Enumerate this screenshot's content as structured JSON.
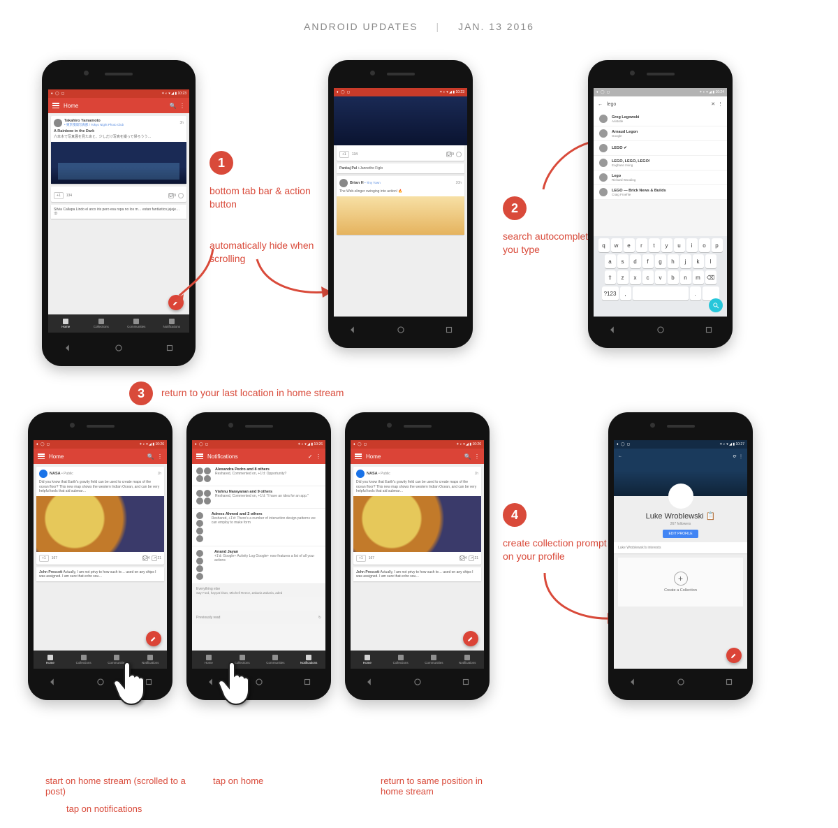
{
  "header": {
    "title": "ANDROID UPDATES",
    "date": "JAN. 13 2016"
  },
  "badges": {
    "b1": "1",
    "b2": "2",
    "b3": "3",
    "b4": "4"
  },
  "annotations": {
    "a1a": "bottom tab bar & action button",
    "a1b": "automatically hide when scrolling",
    "a2": "search autocomplete as you type",
    "a3": "return to your last location in home stream",
    "a4": "create collection prompt on your profile",
    "c1a": "start on home stream (scrolled to a post)",
    "c1b": "tap on notifications",
    "c2": "tap on home",
    "c3": "return to same position in home stream"
  },
  "status": {
    "time1": "10:23",
    "time2": "10:23",
    "time3": "10:24",
    "time4": "10:26",
    "time5": "10:26",
    "time6": "10:26",
    "time7": "10:27"
  },
  "tabs": {
    "home": "Home",
    "collections": "Collections",
    "communities": "Communities",
    "notifications": "Notifications"
  },
  "p1": {
    "appbar": "Home",
    "post1_author": "Takahiro Yamamoto",
    "post1_sub": "• 東京夜間写真部 / Tokyo Night Photo Club",
    "post1_title": "A Rainbow in the Dark",
    "post1_body": "六本木で写真展を見たあと、少しだけ写真を撮って帰ろうう…",
    "post1_time": "3h",
    "plus": "+1",
    "count": "134",
    "comments": "9",
    "snippet": "Silvia Callapa Lindo el arco iris pero esa ropa no los m… estan fantástico jejeje… :D"
  },
  "p2": {
    "plus": "+1",
    "count": "134",
    "comments": "9",
    "post_author": "Pankaj Pal",
    "post_via": "+Jannethe Figlo",
    "post2_author": "Brian H",
    "post2_via": "• Tiny Town",
    "post2_time": "20h",
    "post2_body": "The Web-slinger swinging into action! 🔥"
  },
  "p3": {
    "query": "lego",
    "results": [
      {
        "name": "Greg Legowski",
        "sub": "Aristotle"
      },
      {
        "name": "Arnaud Legon",
        "sub": "Google"
      },
      {
        "name": "LEGO ✔",
        "sub": ""
      },
      {
        "name": "LEGO, LEGO, LEGO!",
        "sub": "Eoghann Irving"
      },
      {
        "name": "Lego",
        "sub": "Richard Wooding"
      },
      {
        "name": "LEGO — Brick News & Builds",
        "sub": "Craig Froehle"
      }
    ],
    "keys_r1": [
      "q",
      "w",
      "e",
      "r",
      "t",
      "y",
      "u",
      "i",
      "o",
      "p"
    ],
    "keys_r2": [
      "a",
      "s",
      "d",
      "f",
      "g",
      "h",
      "j",
      "k",
      "l"
    ],
    "keys_r3": [
      "⇧",
      "z",
      "x",
      "c",
      "v",
      "b",
      "n",
      "m",
      "⌫"
    ],
    "keys_r4": [
      "?123",
      ",",
      "."
    ]
  },
  "home2": {
    "appbar": "Home",
    "post_author": "NASA",
    "post_via": "• Public",
    "post_time": "1h",
    "post_body": "Did you know that Earth's gravity field can be used to create maps of the ocean floor? This new map shows the western Indian Ocean, and can be very helpful tools that aid submar…",
    "plus": "+1",
    "count": "167",
    "comments": "4",
    "shares": "21",
    "snippet_name": "John Prescott",
    "snippet": " Actually,  I am not privy to how such te… used on any ships I was assigned. I am sure that echo sou…"
  },
  "notif": {
    "appbar": "Notifications",
    "items": [
      {
        "t": "Alexandra Pedro and 8 others",
        "d": "Reshared, Commented on, +1'd: Opportunity?"
      },
      {
        "t": "Vishnu Narayanan and 9 others",
        "d": "Reshared, Commented on, +1'd: \"I have an idea for an app.\""
      },
      {
        "t": "Adrees Ahmed and 2 others",
        "d": "Reshared, +1'd: There's a number of interaction design patterns we can employ to make form"
      },
      {
        "t": "Anand Jayan",
        "d": "+1'd: Google+ Activity Log  Google+ now features a list of all your actions"
      }
    ],
    "else": "Everything else",
    "elseSub": "Say Ford, hayyat khan, Mitchell Reece, Zakaria Zakaria, aded",
    "prev": "Previously read"
  },
  "profile": {
    "name": "Luke Wroblewski",
    "followers": "267 followers",
    "edit": "EDIT PROFILE",
    "interests": "Luke Wroblewski's interests",
    "create": "Create a Collection"
  }
}
